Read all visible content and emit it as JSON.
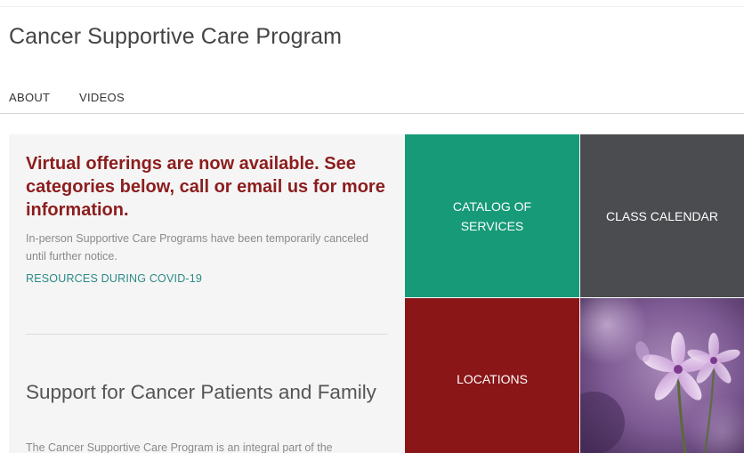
{
  "site": {
    "title": "Cancer Supportive Care Program"
  },
  "nav": {
    "items": [
      {
        "label": "ABOUT"
      },
      {
        "label": "VIDEOS"
      }
    ]
  },
  "notice": {
    "headline": "Virtual offerings are now available. See categories below, call or email us for more information.",
    "subtext": "In-person Supportive Care Programs have been temporarily canceled until further notice.",
    "link_label": "RESOURCES DURING COVID-19"
  },
  "support": {
    "title": "Support for Cancer Patients and Family",
    "body": "The Cancer Supportive Care Program is an integral part of the"
  },
  "tiles": {
    "catalog": "CATALOG OF SERVICES",
    "calendar": "CLASS CALENDAR",
    "locations": "LOCATIONS"
  },
  "colors": {
    "headline": "#8c1d1d",
    "link": "#2a8a86",
    "catalog_tile": "#169a78",
    "calendar_tile": "#4a4c4f",
    "locations_tile": "#8a1618"
  },
  "icons": {
    "photo": "purple-flower-image"
  }
}
